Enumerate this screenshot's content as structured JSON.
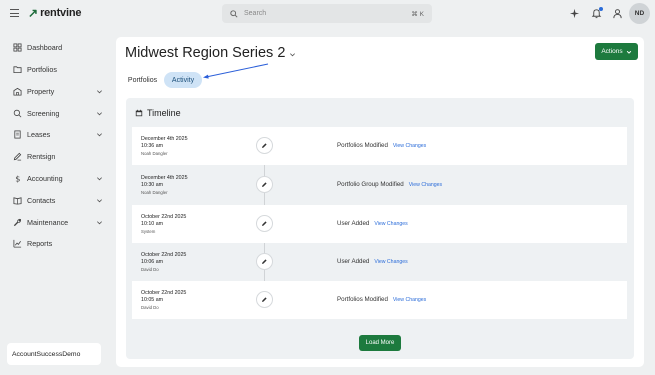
{
  "app": {
    "logo_text": "rentvine",
    "logo_mark": "↗"
  },
  "search": {
    "placeholder": "Search",
    "shortcut": "⌘ K"
  },
  "header": {
    "avatar_initials": "ND"
  },
  "sidebar": {
    "items": [
      {
        "label": "Dashboard",
        "icon": "dashboard-icon",
        "expandable": false
      },
      {
        "label": "Portfolios",
        "icon": "folder-icon",
        "expandable": false
      },
      {
        "label": "Property",
        "icon": "property-icon",
        "expandable": true
      },
      {
        "label": "Screening",
        "icon": "screening-icon",
        "expandable": true
      },
      {
        "label": "Leases",
        "icon": "lease-icon",
        "expandable": true
      },
      {
        "label": "Rentsign",
        "icon": "rentsign-icon",
        "expandable": false
      },
      {
        "label": "Accounting",
        "icon": "dollar-icon",
        "expandable": true
      },
      {
        "label": "Contacts",
        "icon": "contacts-icon",
        "expandable": true
      },
      {
        "label": "Maintenance",
        "icon": "wrench-icon",
        "expandable": true
      },
      {
        "label": "Reports",
        "icon": "reports-icon",
        "expandable": false
      }
    ],
    "account": "AccountSuccessDemo"
  },
  "page": {
    "title": "Midwest Region Series 2",
    "actions_label": "Actions",
    "tabs": [
      {
        "label": "Portfolios",
        "active": false
      },
      {
        "label": "Activity",
        "active": true
      }
    ]
  },
  "timeline": {
    "heading": "Timeline",
    "entries": [
      {
        "date": "December 4th 2025",
        "time": "10:36 am",
        "user": "Noah Dangler",
        "action": "Portfolios Modified",
        "link": "View Changes"
      },
      {
        "date": "December 4th 2025",
        "time": "10:30 am",
        "user": "Noah Dangler",
        "action": "Portfolio Group Modified",
        "link": "View Changes"
      },
      {
        "date": "October 22nd 2025",
        "time": "10:10 am",
        "user": "System",
        "action": "User Added",
        "link": "View Changes"
      },
      {
        "date": "October 22nd 2025",
        "time": "10:06 am",
        "user": "David Do",
        "action": "User Added",
        "link": "View Changes"
      },
      {
        "date": "October 22nd 2025",
        "time": "10:05 am",
        "user": "David Do",
        "action": "Portfolios Modified",
        "link": "View Changes"
      }
    ],
    "load_more_label": "Load More"
  },
  "colors": {
    "brand_green": "#1d7a3e",
    "link_blue": "#2b6cd9",
    "tab_active_bg": "#cfe3f6"
  }
}
